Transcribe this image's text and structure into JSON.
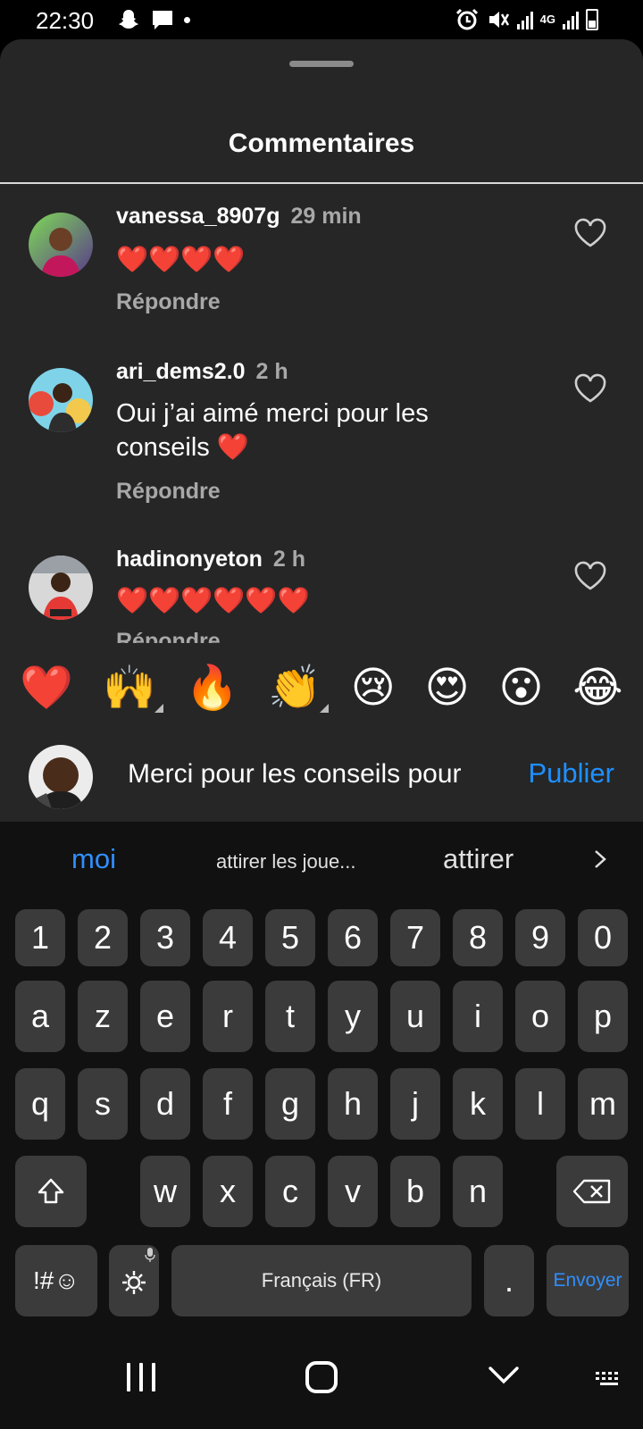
{
  "status_bar": {
    "time": "22:30",
    "left_icons": [
      "snapchat-icon",
      "message-icon",
      "dot-icon"
    ],
    "network_label": "4G",
    "right_icons": [
      "alarm-icon",
      "mute-icon",
      "signal-icon",
      "4g-icon",
      "signal-icon",
      "battery-icon"
    ]
  },
  "sheet": {
    "title": "Commentaires"
  },
  "comments": [
    {
      "username": "vanessa_8907g",
      "time": "29 min",
      "lines": [
        "❤️❤️❤️❤️"
      ],
      "reply_label": "Répondre"
    },
    {
      "username": "ari_dems2.0",
      "time": "2 h",
      "lines": [
        "Oui j’ai aimé merci pour les",
        "conseils ❤️"
      ],
      "reply_label": "Répondre"
    },
    {
      "username": "hadinonyeton",
      "time": "2 h",
      "lines": [
        "❤️❤️❤️❤️❤️❤️"
      ],
      "reply_label": "Répondre"
    }
  ],
  "quick_reactions": [
    "❤️",
    "🙌",
    "🔥",
    "👏",
    "😢",
    "😍",
    "😮",
    "😂"
  ],
  "composer": {
    "input_value": "Merci pour les conseils pour",
    "publish_label": "Publier"
  },
  "keyboard": {
    "suggestions": [
      "moi",
      "attirer les joue...",
      "attirer"
    ],
    "row_numbers": [
      "1",
      "2",
      "3",
      "4",
      "5",
      "6",
      "7",
      "8",
      "9",
      "0"
    ],
    "row1": [
      "a",
      "z",
      "e",
      "r",
      "t",
      "y",
      "u",
      "i",
      "o",
      "p"
    ],
    "row2": [
      "q",
      "s",
      "d",
      "f",
      "g",
      "h",
      "j",
      "k",
      "l",
      "m"
    ],
    "row3": [
      "w",
      "x",
      "c",
      "v",
      "b",
      "n"
    ],
    "symbols_label": "!#☺",
    "space_label": "Français (FR)",
    "period_label": ".",
    "send_label": "Envoyer"
  },
  "colors": {
    "accent": "#2f8fff",
    "sheet_bg": "#262626",
    "keyboard_bg": "#111111",
    "key_bg": "#3b3b3b"
  }
}
